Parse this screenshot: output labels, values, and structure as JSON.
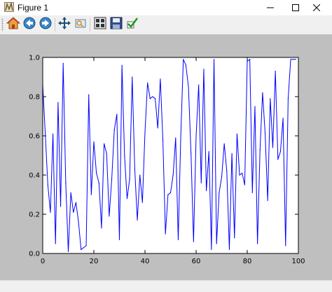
{
  "window": {
    "title": "Figure 1"
  },
  "toolbar": {
    "buttons": [
      {
        "name": "home-button",
        "icon": "home-icon"
      },
      {
        "name": "back-button",
        "icon": "back-arrow-icon"
      },
      {
        "name": "forward-button",
        "icon": "forward-arrow-icon"
      },
      {
        "name": "pan-button",
        "icon": "move-icon"
      },
      {
        "name": "zoom-button",
        "icon": "zoom-rect-icon"
      },
      {
        "name": "subplots-button",
        "icon": "subplots-icon"
      },
      {
        "name": "save-button",
        "icon": "floppy-disk-icon"
      },
      {
        "name": "edit-button",
        "icon": "checkmark-icon"
      }
    ]
  },
  "colors": {
    "line": "#0000ff",
    "canvas": "#bfbfbf",
    "axes_bg": "#ffffff"
  },
  "chart_data": {
    "type": "line",
    "title": "",
    "xlabel": "",
    "ylabel": "",
    "xlim": [
      0,
      100
    ],
    "ylim": [
      0.0,
      1.0
    ],
    "xticks": [
      "0",
      "20",
      "40",
      "60",
      "80",
      "100"
    ],
    "yticks": [
      "0.0",
      "0.2",
      "0.4",
      "0.6",
      "0.8",
      "1.0"
    ],
    "grid": false,
    "series": [
      {
        "x": [
          0,
          1,
          2,
          3,
          4,
          5,
          6,
          7,
          8,
          9,
          10,
          11,
          12,
          13,
          14,
          15,
          16,
          17,
          18,
          19,
          20,
          21,
          22,
          23,
          24,
          25,
          26,
          27,
          28,
          29,
          30,
          31,
          32,
          33,
          34,
          35,
          36,
          37,
          38,
          39,
          40,
          41,
          42,
          43,
          44,
          45,
          46,
          47,
          48,
          49,
          50,
          51,
          52,
          53,
          54,
          55,
          56,
          57,
          58,
          59,
          60,
          61,
          62,
          63,
          64,
          65,
          66,
          67,
          68,
          69,
          70,
          71,
          72,
          73,
          74,
          75,
          76,
          77,
          78,
          79,
          80,
          81,
          82,
          83,
          84,
          85,
          86,
          87,
          88,
          89,
          90,
          91,
          92,
          93,
          94,
          95,
          96,
          97,
          98,
          99
        ],
        "y": [
          0.86,
          0.61,
          0.35,
          0.21,
          0.61,
          0.05,
          0.77,
          0.24,
          0.97,
          0.36,
          0.01,
          0.31,
          0.21,
          0.26,
          0.16,
          0.02,
          0.03,
          0.04,
          0.81,
          0.3,
          0.57,
          0.41,
          0.36,
          0.13,
          0.56,
          0.51,
          0.19,
          0.38,
          0.63,
          0.71,
          0.07,
          0.96,
          0.5,
          0.28,
          0.38,
          0.9,
          0.43,
          0.17,
          0.4,
          0.26,
          0.62,
          0.87,
          0.79,
          0.8,
          0.79,
          0.64,
          0.89,
          0.58,
          0.1,
          0.3,
          0.31,
          0.4,
          0.59,
          0.07,
          0.6,
          0.99,
          0.96,
          0.85,
          0.51,
          0.06,
          0.6,
          0.86,
          0.36,
          0.94,
          0.32,
          0.52,
          0.02,
          0.99,
          0.05,
          0.31,
          0.39,
          0.56,
          0.42,
          0.02,
          0.51,
          0.08,
          0.61,
          0.4,
          0.41,
          0.35,
          0.98,
          0.99,
          0.31,
          0.75,
          0.05,
          0.53,
          0.82,
          0.61,
          0.27,
          0.79,
          0.54,
          0.93,
          0.48,
          0.52,
          0.69,
          0.04,
          0.79,
          0.99,
          0.99,
          0.99
        ]
      }
    ]
  }
}
